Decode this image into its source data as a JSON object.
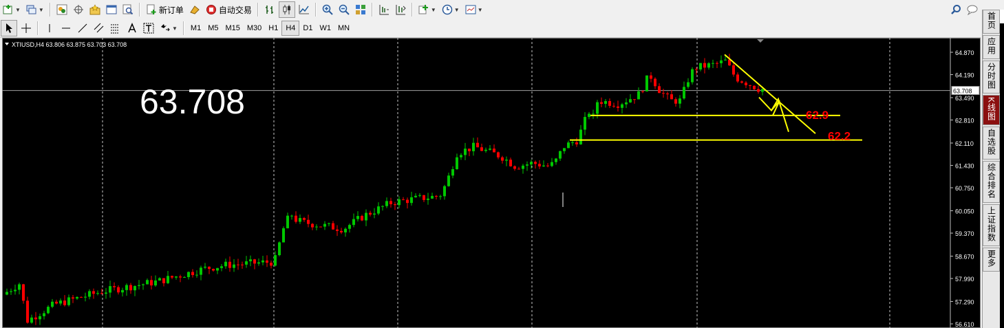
{
  "toolbar_top": {
    "new_order_label": "新订单",
    "auto_trade_label": "自动交易"
  },
  "timeframes": [
    "M1",
    "M5",
    "M15",
    "M30",
    "H1",
    "H4",
    "D1",
    "W1",
    "MN"
  ],
  "active_timeframe": "H4",
  "chart": {
    "info_label": "XTIUSD,H4  63.806 63.875 63.703 63.708",
    "big_price": "63.708",
    "current_price_tag": "63.708",
    "price_axis": [
      "64.870",
      "64.190",
      "63.490",
      "62.810",
      "62.110",
      "61.430",
      "60.750",
      "60.050",
      "59.370",
      "58.670",
      "57.990",
      "57.290",
      "56.610"
    ],
    "annotations": [
      "62.9",
      "62.2"
    ],
    "colors": {
      "bull": "#00c800",
      "bear": "#ff0000",
      "trendline": "#ffff00",
      "label": "#ff0000",
      "background": "#000000"
    }
  },
  "sidebar": {
    "items": [
      {
        "label": "首页"
      },
      {
        "label": "应用"
      },
      {
        "label": "分时图"
      },
      {
        "label": "K线图"
      },
      {
        "label": "自选股"
      },
      {
        "label": "综合排名"
      },
      {
        "label": "上证指数"
      },
      {
        "label": "更多"
      }
    ]
  }
}
